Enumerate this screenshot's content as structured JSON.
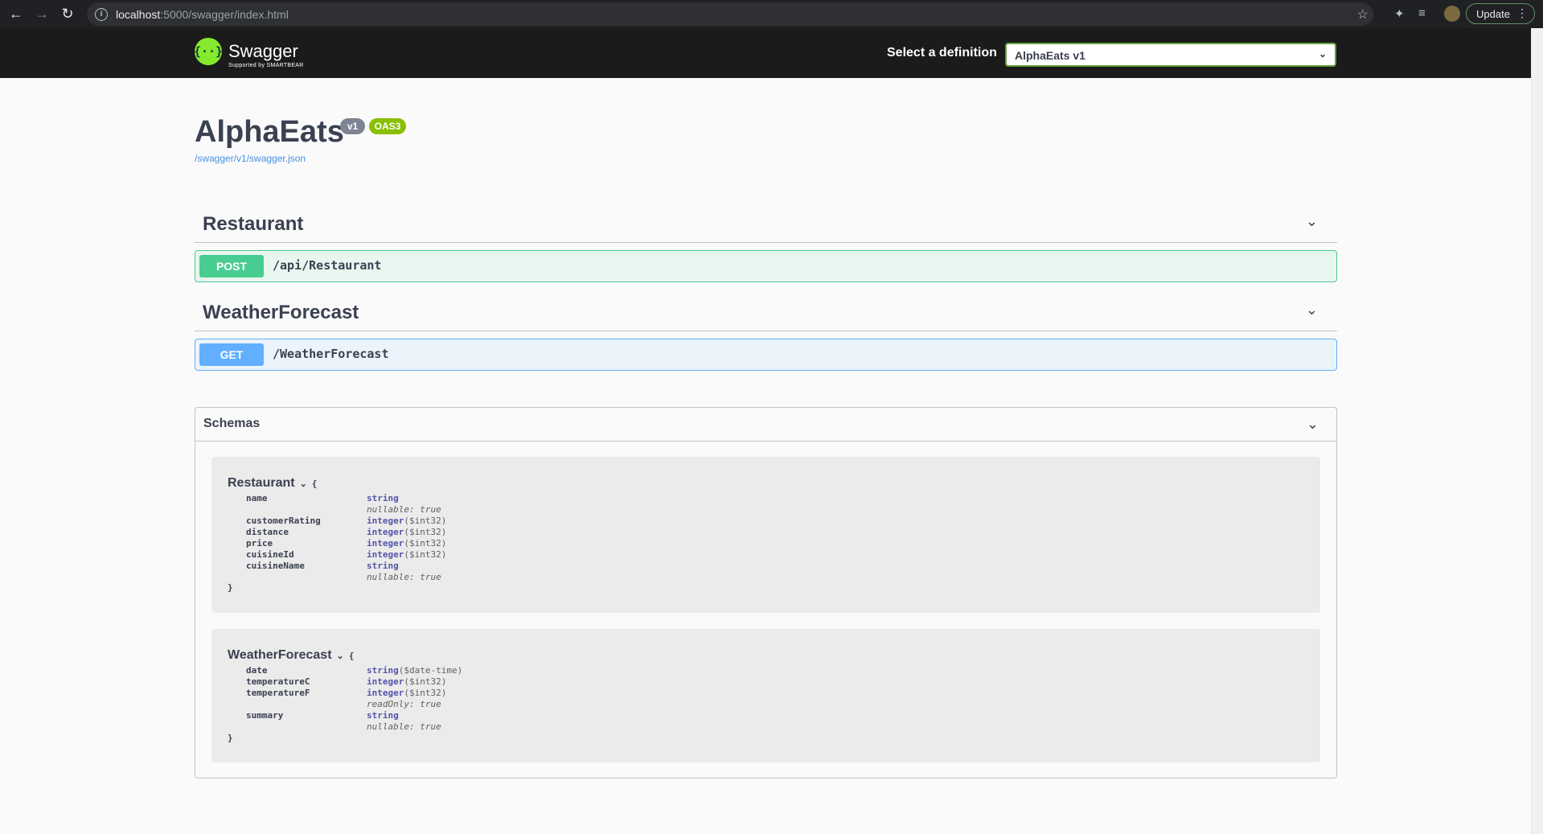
{
  "browser": {
    "url_host": "localhost",
    "url_path": ":5000/swagger/index.html",
    "update_label": "Update"
  },
  "topbar": {
    "logo_text": "Swagger",
    "logo_sub": "Supported by SMARTBEAR",
    "definition_label": "Select a definition",
    "definition_value": "AlphaEats v1"
  },
  "info": {
    "title": "AlphaEats",
    "version_badge": "v1",
    "oas_badge": "OAS3",
    "spec_link": "/swagger/v1/swagger.json"
  },
  "tags": [
    {
      "name": "Restaurant",
      "operation": {
        "method": "POST",
        "path": "/api/Restaurant"
      }
    },
    {
      "name": "WeatherForecast",
      "operation": {
        "method": "GET",
        "path": "/WeatherForecast"
      }
    }
  ],
  "schemas": {
    "label": "Schemas",
    "models": [
      {
        "name": "Restaurant",
        "open": "{",
        "close": "}",
        "props": [
          {
            "name": "name",
            "type": "string",
            "format": "",
            "note": "nullable: true"
          },
          {
            "name": "customerRating",
            "type": "integer",
            "format": "($int32)",
            "note": ""
          },
          {
            "name": "distance",
            "type": "integer",
            "format": "($int32)",
            "note": ""
          },
          {
            "name": "price",
            "type": "integer",
            "format": "($int32)",
            "note": ""
          },
          {
            "name": "cuisineId",
            "type": "integer",
            "format": "($int32)",
            "note": ""
          },
          {
            "name": "cuisineName",
            "type": "string",
            "format": "",
            "note": "nullable: true"
          }
        ]
      },
      {
        "name": "WeatherForecast",
        "open": "{",
        "close": "}",
        "props": [
          {
            "name": "date",
            "type": "string",
            "format": "($date-time)",
            "note": ""
          },
          {
            "name": "temperatureC",
            "type": "integer",
            "format": "($int32)",
            "note": ""
          },
          {
            "name": "temperatureF",
            "type": "integer",
            "format": "($int32)",
            "note": "readOnly: true"
          },
          {
            "name": "summary",
            "type": "string",
            "format": "",
            "note": "nullable: true"
          }
        ]
      }
    ]
  },
  "colors": {
    "post": "#49cc90",
    "get": "#61affe",
    "oas_badge": "#89bf04",
    "logo": "#85ea2d"
  }
}
